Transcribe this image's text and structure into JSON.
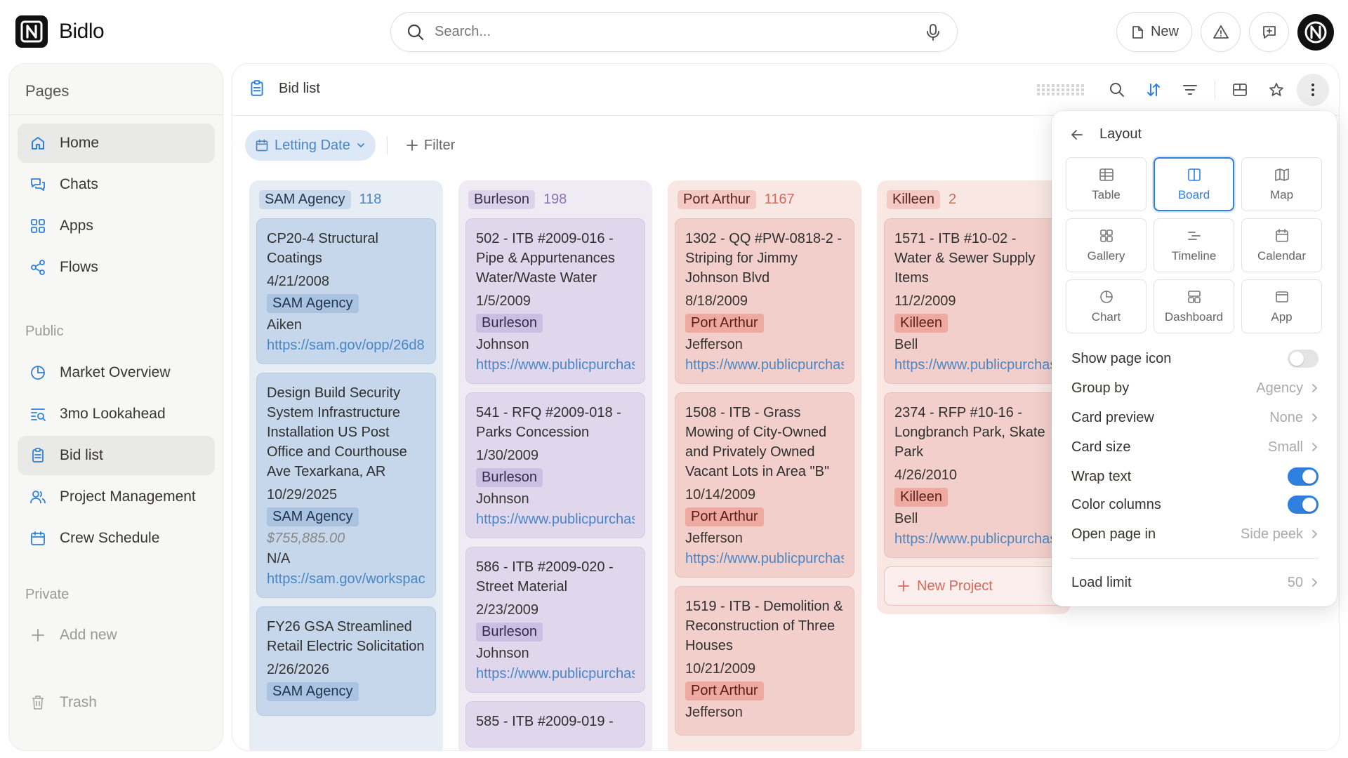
{
  "app": {
    "name": "Bidlo"
  },
  "search": {
    "placeholder": "Search..."
  },
  "topbar": {
    "new_label": "New"
  },
  "sidebar": {
    "title": "Pages",
    "items": [
      {
        "label": "Home",
        "icon": "home-icon"
      },
      {
        "label": "Chats",
        "icon": "chat-icon"
      },
      {
        "label": "Apps",
        "icon": "apps-icon"
      },
      {
        "label": "Flows",
        "icon": "flows-icon"
      }
    ],
    "public_label": "Public",
    "public_items": [
      {
        "label": "Market Overview",
        "icon": "pie-chart-icon"
      },
      {
        "label": "3mo Lookahead",
        "icon": "lookahead-icon"
      },
      {
        "label": "Bid list",
        "icon": "clipboard-icon",
        "active": true
      },
      {
        "label": "Project Management",
        "icon": "people-icon"
      },
      {
        "label": "Crew Schedule",
        "icon": "calendar-icon"
      }
    ],
    "private_label": "Private",
    "add_new": "Add new",
    "trash": "Trash"
  },
  "page": {
    "title": "Bid list"
  },
  "filters": {
    "chip": "Letting Date",
    "filter": "Filter"
  },
  "board": {
    "columns": [
      {
        "name": "SAM Agency",
        "count": "118",
        "cards": [
          {
            "title": "CP20-4 Structural Coatings",
            "date": "4/21/2008",
            "tag": "SAM Agency",
            "location": "Aiken",
            "link": "https://sam.gov/opp/26d8"
          },
          {
            "title": "Design Build Security System Infrastructure Installation US Post Office and Courthouse Ave Texarkana, AR",
            "date": "10/29/2025",
            "tag": "SAM Agency",
            "price": "$755,885.00",
            "location": "N/A",
            "link": "https://sam.gov/workspace"
          },
          {
            "title": "FY26 GSA Streamlined Retail Electric Solicitation",
            "date": "2/26/2026",
            "tag": "SAM Agency"
          }
        ]
      },
      {
        "name": "Burleson",
        "count": "198",
        "cards": [
          {
            "title": "502 - ITB #2009-016 - Pipe & Appurtenances Water/Waste Water",
            "date": "1/5/2009",
            "tag": "Burleson",
            "location": "Johnson",
            "link": "https://www.publicpurchase"
          },
          {
            "title": "541 - RFQ #2009-018 - Parks Concession",
            "date": "1/30/2009",
            "tag": "Burleson",
            "location": "Johnson",
            "link": "https://www.publicpurchase"
          },
          {
            "title": "586 - ITB #2009-020 - Street Material",
            "date": "2/23/2009",
            "tag": "Burleson",
            "location": "Johnson",
            "link": "https://www.publicpurchase"
          },
          {
            "title": "585 - ITB #2009-019 -"
          }
        ]
      },
      {
        "name": "Port Arthur",
        "count": "1167",
        "cards": [
          {
            "title": "1302 - QQ #PW-0818-2 - Striping for Jimmy Johnson Blvd",
            "date": "8/18/2009",
            "tag": "Port Arthur",
            "location": "Jefferson",
            "link": "https://www.publicpurchase"
          },
          {
            "title": "1508 - ITB - Grass Mowing of City-Owned and Privately Owned Vacant Lots in Area \"B\"",
            "date": "10/14/2009",
            "tag": "Port Arthur",
            "location": "Jefferson",
            "link": "https://www.publicpurchase"
          },
          {
            "title": "1519 - ITB - Demolition & Reconstruction of Three Houses",
            "date": "10/21/2009",
            "tag": "Port Arthur",
            "location": "Jefferson"
          }
        ]
      },
      {
        "name": "Killeen",
        "count": "2",
        "cards": [
          {
            "title": "1571 - ITB #10-02 - Water & Sewer Supply Items",
            "date": "11/2/2009",
            "tag": "Killeen",
            "location": "Bell",
            "link": "https://www.publicpurchase"
          },
          {
            "title": "2374 - RFP #10-16 - Longbranch Park, Skate Park",
            "date": "4/26/2010",
            "tag": "Killeen",
            "location": "Bell",
            "link": "https://www.publicpurchase"
          }
        ],
        "new_project": "New Project"
      }
    ]
  },
  "layout_menu": {
    "title": "Layout",
    "options": [
      {
        "label": "Table",
        "icon": "table-icon"
      },
      {
        "label": "Board",
        "icon": "board-icon",
        "selected": true
      },
      {
        "label": "Map",
        "icon": "map-icon"
      },
      {
        "label": "Gallery",
        "icon": "gallery-icon"
      },
      {
        "label": "Timeline",
        "icon": "timeline-icon"
      },
      {
        "label": "Calendar",
        "icon": "calendar-icon"
      },
      {
        "label": "Chart",
        "icon": "chart-icon"
      },
      {
        "label": "Dashboard",
        "icon": "dashboard-icon"
      },
      {
        "label": "App",
        "icon": "app-icon"
      }
    ],
    "settings": {
      "show_page_icon": {
        "label": "Show page icon",
        "on": false
      },
      "group_by": {
        "label": "Group by",
        "value": "Agency"
      },
      "card_preview": {
        "label": "Card preview",
        "value": "None"
      },
      "card_size": {
        "label": "Card size",
        "value": "Small"
      },
      "wrap_text": {
        "label": "Wrap text",
        "on": true
      },
      "color_columns": {
        "label": "Color columns",
        "on": true
      },
      "open_page_in": {
        "label": "Open page in",
        "value": "Side peek"
      },
      "load_limit": {
        "label": "Load limit",
        "value": "50"
      }
    }
  },
  "colors": {
    "accent": "#2f7fde",
    "link": "#4a86c5"
  }
}
